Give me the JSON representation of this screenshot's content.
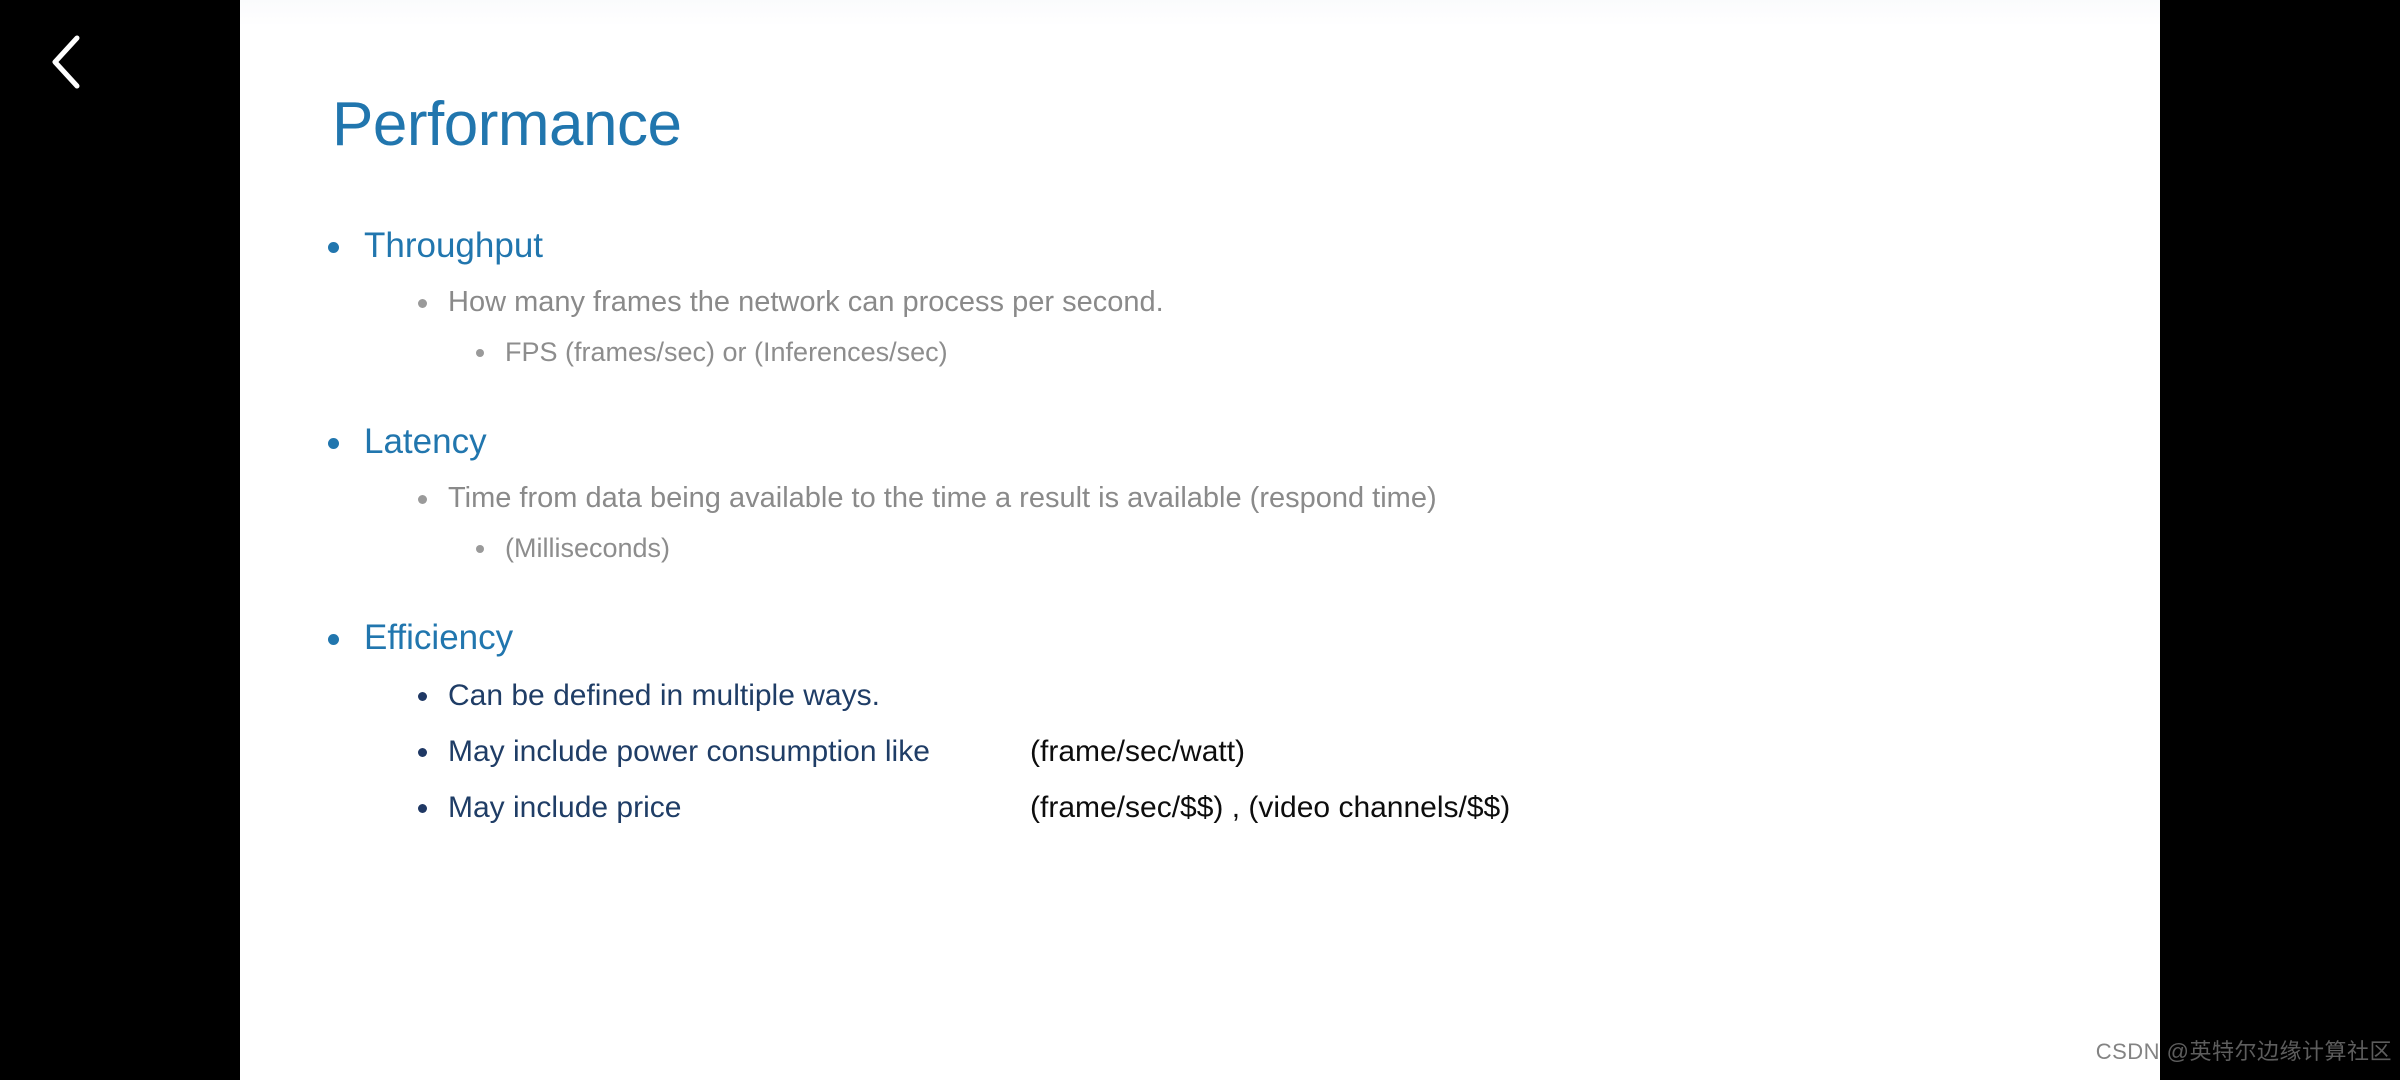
{
  "player": {
    "back_icon": "chevron-left-icon",
    "background_color": "#000000"
  },
  "slide": {
    "title": "Performance",
    "title_color": "#2176AE",
    "background_color": "#FFFFFF",
    "sections": [
      {
        "heading": "Throughput",
        "sub_items": [
          {
            "level": 2,
            "text": "How many frames the network can process per second.",
            "color": "#8A8A8A"
          },
          {
            "level": 3,
            "text": "FPS (frames/sec) or (Inferences/sec)",
            "color": "#8D8D8D"
          }
        ]
      },
      {
        "heading": "Latency",
        "sub_items": [
          {
            "level": 2,
            "text": "Time from data being available to the time a result is available (respond time)",
            "color": "#8A8A8A"
          },
          {
            "level": 3,
            "text": "(Milliseconds)",
            "color": "#8D8D8D"
          }
        ]
      },
      {
        "heading": "Efficiency",
        "sub_items": [
          {
            "level": 2,
            "text": "Can be defined in multiple ways.",
            "color": "#1F3D66",
            "formula": ""
          },
          {
            "level": 2,
            "text": "May include power consumption like",
            "color": "#1F3D66",
            "formula": "(frame/sec/watt)"
          },
          {
            "level": 2,
            "text": "May include price",
            "color": "#1F3D66",
            "formula": "(frame/sec/$$) ,  (video channels/$$)"
          }
        ]
      }
    ]
  },
  "watermark": {
    "text": "CSDN @英特尔边缘计算社区"
  }
}
